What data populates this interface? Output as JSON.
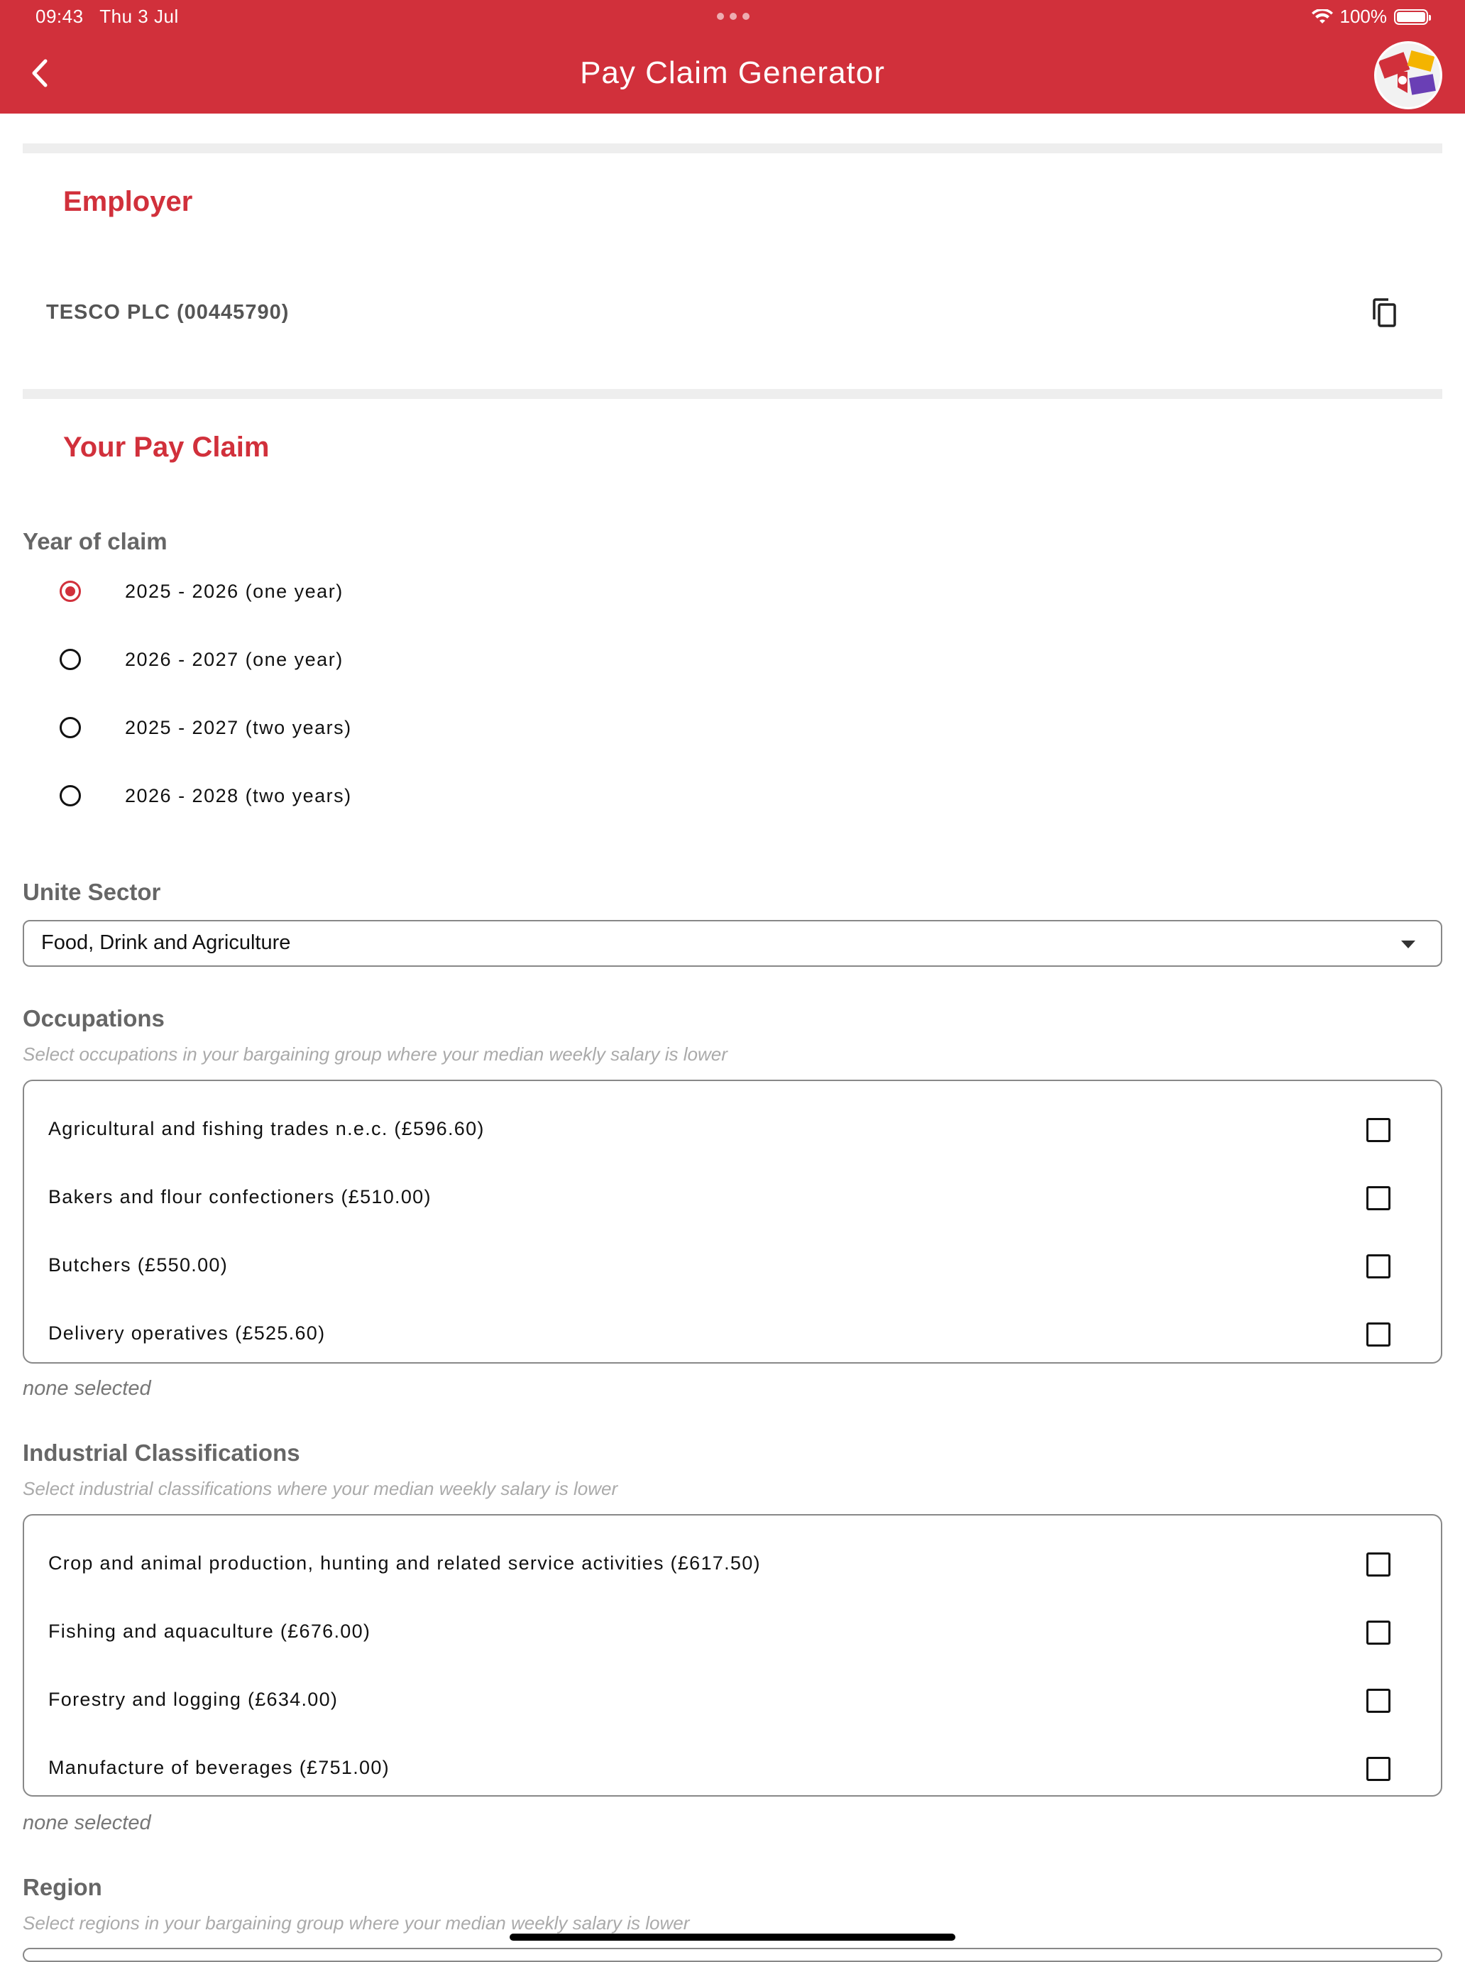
{
  "status_bar": {
    "time": "09:43",
    "date": "Thu 3 Jul",
    "battery": "100%"
  },
  "header": {
    "title": "Pay Claim Generator",
    "back_icon": "chevron-left-icon",
    "background_color": "#d1303b"
  },
  "employer": {
    "section_title": "Employer",
    "name": "TESCO PLC (00445790)",
    "copy_icon": "copy-icon"
  },
  "pay_claim": {
    "section_title": "Your Pay Claim",
    "year_label": "Year of claim",
    "year_options": [
      {
        "label": "2025 - 2026 (one year)",
        "selected": true
      },
      {
        "label": "2026 - 2027 (one year)",
        "selected": false
      },
      {
        "label": "2025 - 2027 (two years)",
        "selected": false
      },
      {
        "label": "2026 - 2028 (two years)",
        "selected": false
      }
    ]
  },
  "sector": {
    "label": "Unite Sector",
    "value": "Food, Drink and Agriculture"
  },
  "occupations": {
    "label": "Occupations",
    "hint": "Select occupations in your bargaining group where your median weekly salary is lower",
    "items": [
      "Agricultural and fishing trades n.e.c. (£596.60)",
      "Bakers and flour confectioners (£510.00)",
      "Butchers (£550.00)",
      "Delivery operatives (£525.60)"
    ],
    "status": "none selected"
  },
  "industrial": {
    "label": "Industrial Classifications",
    "hint": "Select industrial classifications where your median weekly salary is lower",
    "items": [
      "Crop and animal production, hunting and related service activities (£617.50)",
      "Fishing and aquaculture (£676.00)",
      "Forestry and logging (£634.00)",
      "Manufacture of beverages (£751.00)"
    ],
    "status": "none selected"
  },
  "region": {
    "label": "Region",
    "hint": "Select regions in your bargaining group where your median weekly salary is lower"
  },
  "colors": {
    "accent": "#d1303b",
    "label_gray": "#666666",
    "divider": "#eeeeee"
  }
}
